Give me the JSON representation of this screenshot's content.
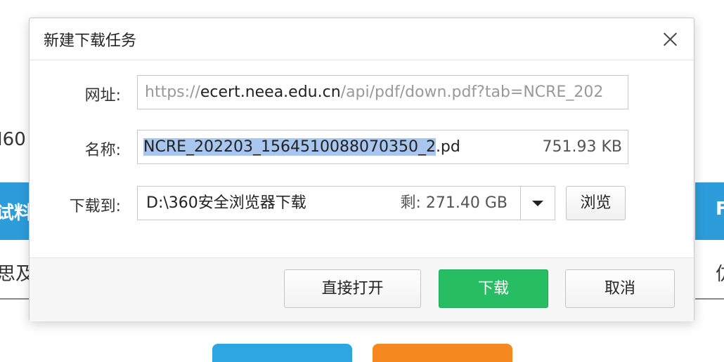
{
  "background": {
    "left_fragment_1": "I60",
    "left_band_text": "试料",
    "left_fragment_2": "思及",
    "right_band_text": "F",
    "right_fragment": "仿",
    "colors": {
      "band": "#2d9cdb",
      "btn_blue": "#2ea7e0",
      "btn_orange": "#f5891f"
    }
  },
  "dialog": {
    "title": "新建下载任务",
    "close_icon": "close-icon",
    "url": {
      "label": "网址:",
      "prefix": "https://",
      "host": "ecert.neea.edu.cn",
      "path": "/api/pdf/down.pdf?tab=NCRE_202"
    },
    "name": {
      "label": "名称:",
      "selected": "NCRE_202203_1564510088070350_2",
      "suffix": ".pd",
      "size": "751.93 KB"
    },
    "save_to": {
      "label": "下载到:",
      "path": "D:\\360安全浏览器下载",
      "free": "剩: 271.40 GB",
      "dropdown_icon": "chevron-down-icon",
      "browse_label": "浏览"
    },
    "buttons": {
      "open_label": "直接打开",
      "download_label": "下载",
      "cancel_label": "取消"
    },
    "colors": {
      "download": "#27be63",
      "selection": "#a9c6ee"
    }
  }
}
